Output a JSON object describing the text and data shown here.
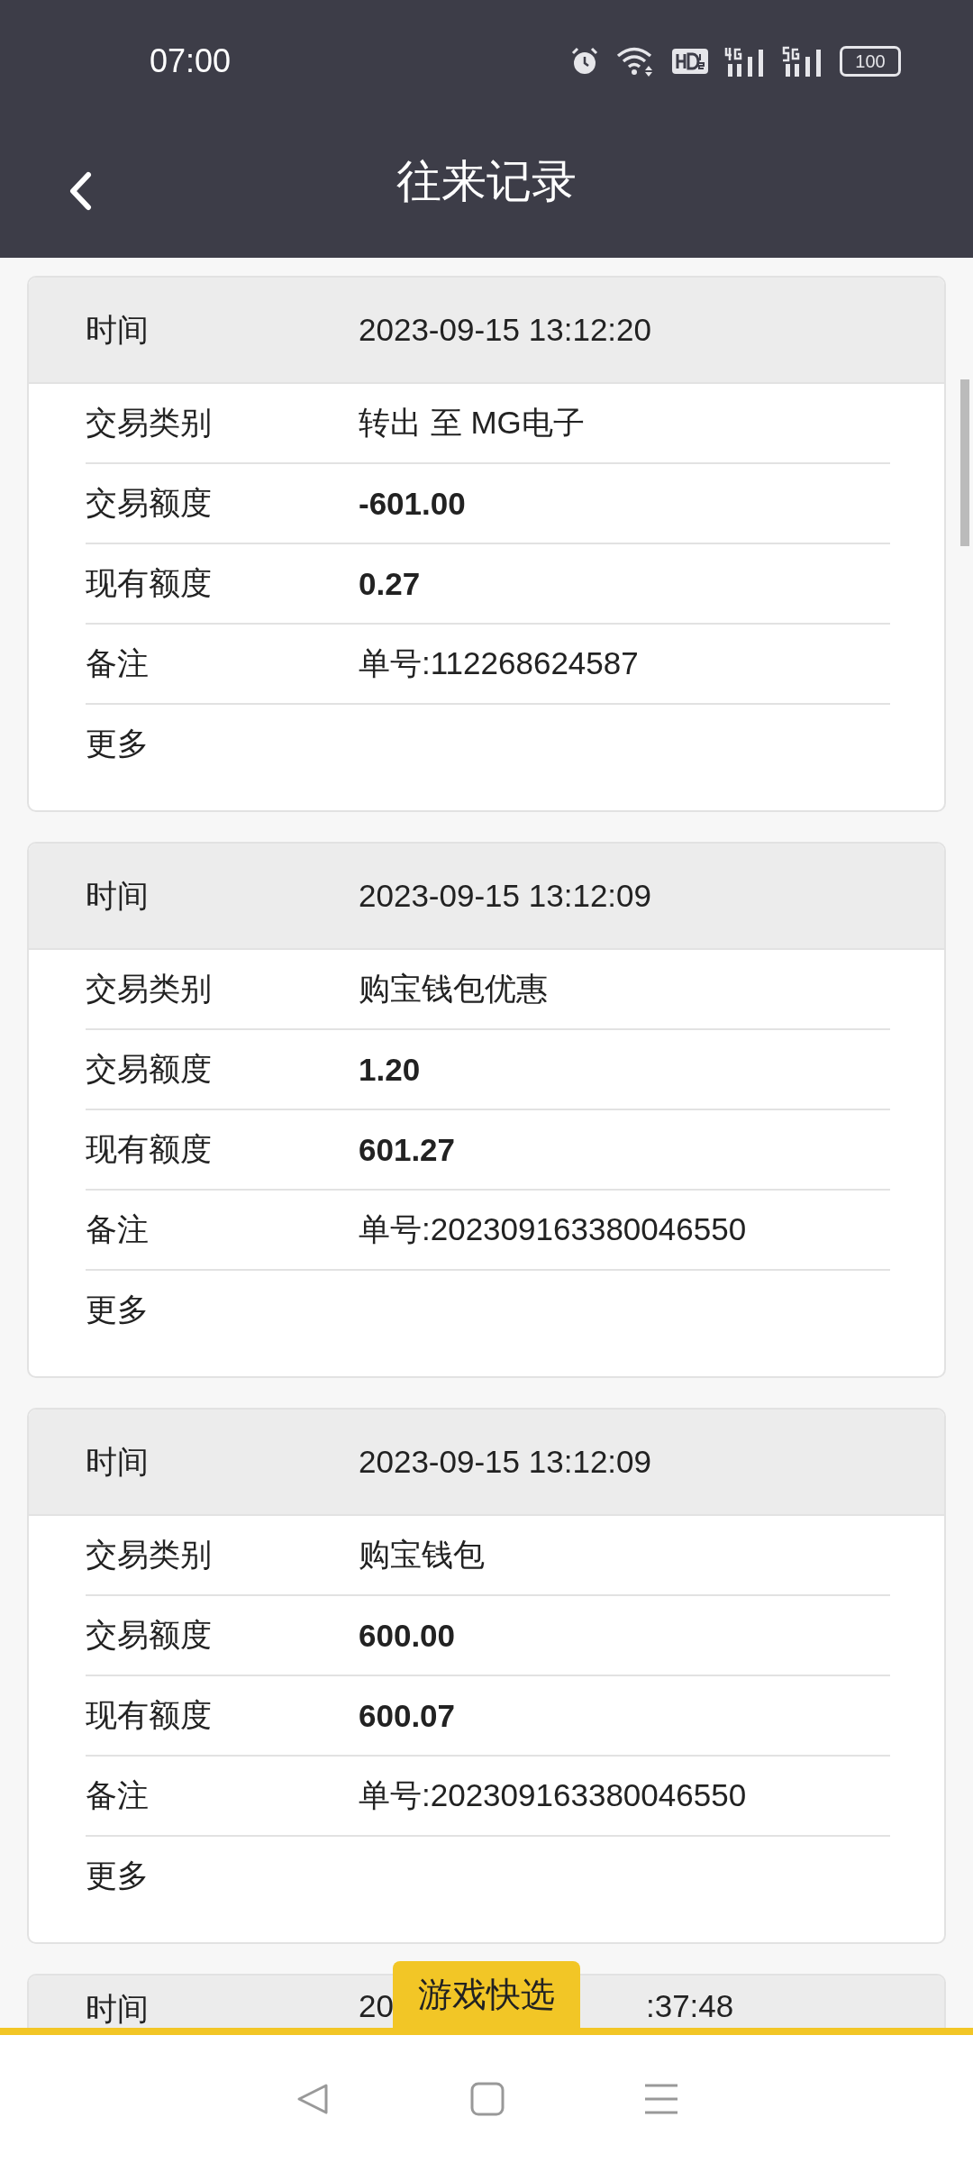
{
  "status_bar": {
    "time": "07:00",
    "battery": "100"
  },
  "header": {
    "title": "往来记录"
  },
  "records": [
    {
      "time_label": "时间",
      "time": "2023-09-15 13:12:20",
      "rows": [
        {
          "label": "交易类别",
          "value": "转出 至 MG电子",
          "bold": false
        },
        {
          "label": "交易额度",
          "value": "-601.00",
          "bold": true
        },
        {
          "label": "现有额度",
          "value": "0.27",
          "bold": true
        },
        {
          "label": "备注",
          "value": "单号:112268624587",
          "bold": false
        },
        {
          "label": "更多"
        }
      ]
    },
    {
      "time_label": "时间",
      "time": "2023-09-15 13:12:09",
      "rows": [
        {
          "label": "交易类别",
          "value": "购宝钱包优惠",
          "bold": false
        },
        {
          "label": "交易额度",
          "value": "1.20",
          "bold": true
        },
        {
          "label": "现有额度",
          "value": "601.27",
          "bold": true
        },
        {
          "label": "备注",
          "value": "单号:202309163380046550",
          "bold": false
        },
        {
          "label": "更多"
        }
      ]
    },
    {
      "time_label": "时间",
      "time": "2023-09-15 13:12:09",
      "rows": [
        {
          "label": "交易类别",
          "value": "购宝钱包",
          "bold": false
        },
        {
          "label": "交易额度",
          "value": "600.00",
          "bold": true
        },
        {
          "label": "现有额度",
          "value": "600.07",
          "bold": true
        },
        {
          "label": "备注",
          "value": "单号:202309163380046550",
          "bold": false
        },
        {
          "label": "更多"
        }
      ]
    }
  ],
  "partial_record": {
    "time_label": "时间",
    "time_start": "20",
    "time_end": ":37:48"
  },
  "quick_pick_button": "游戏快选"
}
